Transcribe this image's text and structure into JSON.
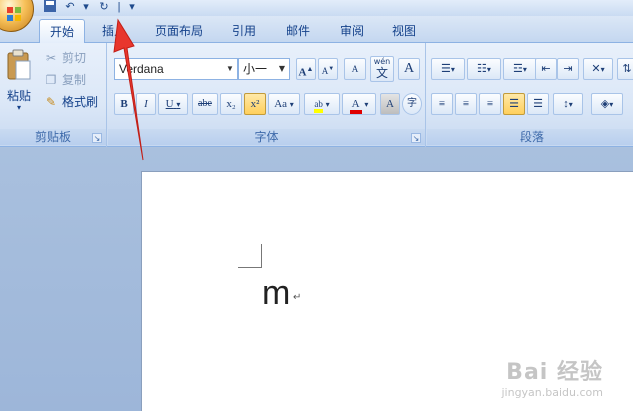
{
  "tabs": [
    {
      "label": "开始",
      "active": true
    },
    {
      "label": "插入",
      "active": false
    },
    {
      "label": "页面布局",
      "active": false
    },
    {
      "label": "引用",
      "active": false
    },
    {
      "label": "邮件",
      "active": false
    },
    {
      "label": "审阅",
      "active": false
    },
    {
      "label": "视图",
      "active": false
    }
  ],
  "clipboard": {
    "paste_label": "粘贴",
    "cut_label": "剪切",
    "copy_label": "复制",
    "format_painter_label": "格式刷",
    "group_label": "剪贴板"
  },
  "font": {
    "font_name": "Verdana",
    "font_size": "小一",
    "group_label": "字体",
    "bold_label": "B",
    "italic_label": "I",
    "underline_label": "U",
    "strike_label": "abe",
    "subscript_label": "x₂",
    "superscript_label": "x²",
    "change_case_label": "Aa",
    "grow_label": "A",
    "shrink_label": "A",
    "clear_label": "A",
    "phonetic_label": "wén",
    "phonetic_char": "文",
    "border_char": "A",
    "highlight_label": "ab",
    "font_color_label": "A",
    "shading_label": "A",
    "enclose_char": "字"
  },
  "paragraph": {
    "group_label": "段落"
  },
  "document": {
    "text": "m"
  },
  "watermark": {
    "main": "Bai 经验",
    "sub": "jingyan.baidu.com"
  },
  "colors": {
    "accent": "#15428b",
    "arrow": "#e8362d",
    "highlight": "#ffff00",
    "font_color": "#e00000"
  }
}
